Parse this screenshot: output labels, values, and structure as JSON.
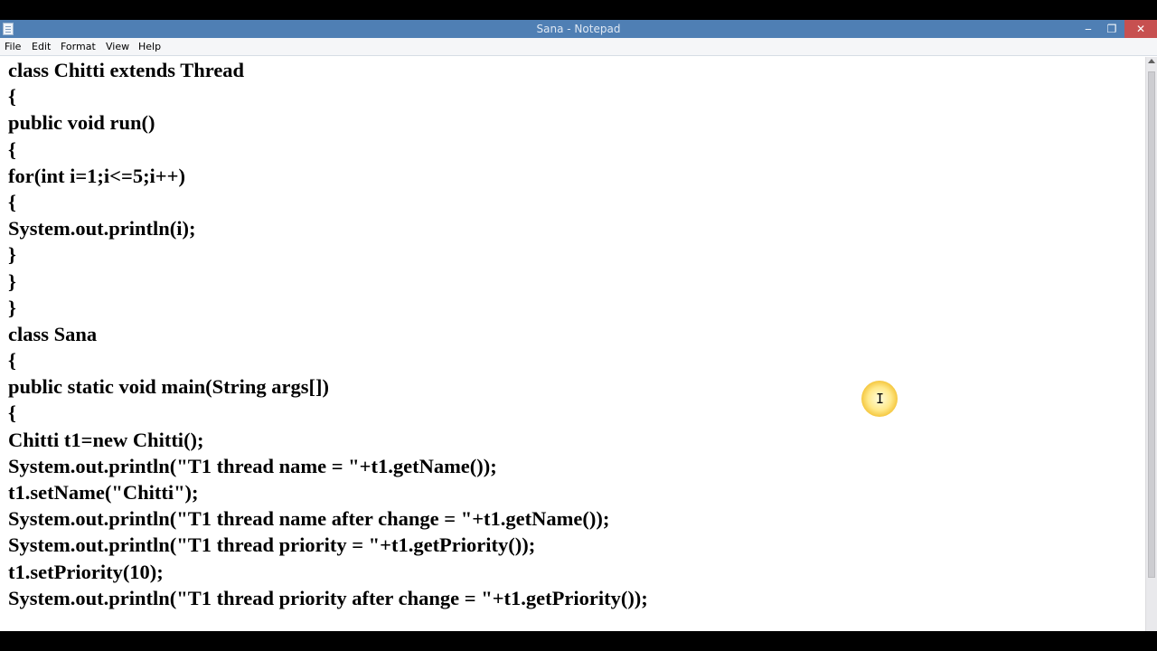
{
  "window": {
    "title": "Sana - Notepad",
    "controls": {
      "minimize": "‒",
      "maximize": "❐",
      "close": "✕"
    }
  },
  "menu": [
    "File",
    "Edit",
    "Format",
    "View",
    "Help"
  ],
  "editor": {
    "lines": [
      "class Chitti extends Thread",
      "{",
      "public void run()",
      "{",
      "for(int i=1;i<=5;i++)",
      "{",
      "System.out.println(i);",
      "}",
      "}",
      "}",
      "class Sana",
      "{",
      "public static void main(String args[])",
      "{",
      "Chitti t1=new Chitti();",
      "System.out.println(\"T1 thread name = \"+t1.getName());",
      "t1.setName(\"Chitti\");",
      "System.out.println(\"T1 thread name after change = \"+t1.getName());",
      "System.out.println(\"T1 thread priority = \"+t1.getPriority());",
      "t1.setPriority(10);",
      "System.out.println(\"T1 thread priority after change = \"+t1.getPriority());"
    ]
  },
  "cursor": {
    "glyph": "I"
  }
}
